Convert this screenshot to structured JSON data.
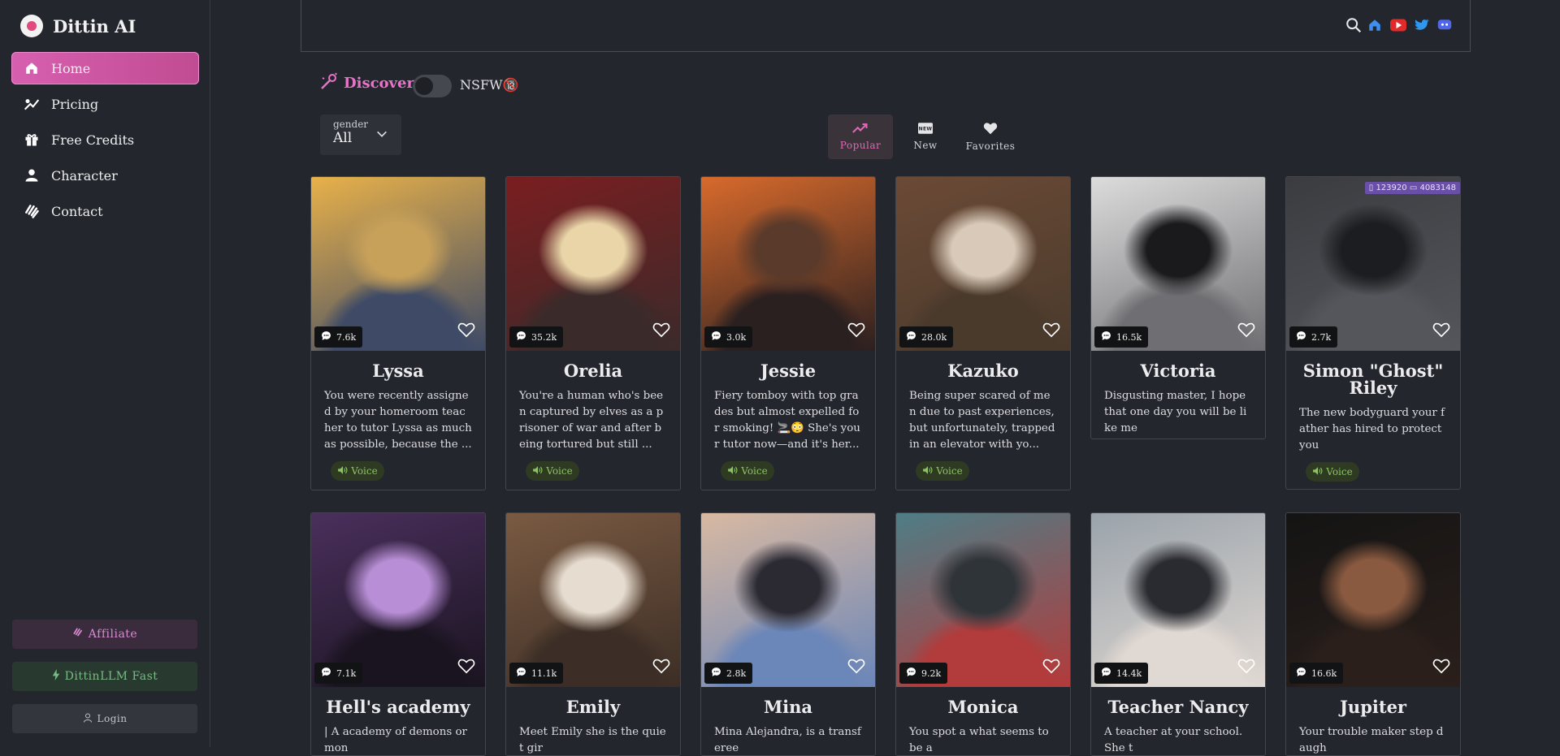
{
  "app": {
    "name": "Dittin AI"
  },
  "sidebar": {
    "items": [
      {
        "label": "Home",
        "icon": "home-icon",
        "active": true
      },
      {
        "label": "Pricing",
        "icon": "pricing-icon",
        "active": false
      },
      {
        "label": "Free Credits",
        "icon": "gift-icon",
        "active": false
      },
      {
        "label": "Character",
        "icon": "person-icon",
        "active": false
      },
      {
        "label": "Contact",
        "icon": "contact-icon",
        "active": false
      }
    ],
    "affiliate_label": "Affiliate",
    "llm_label": "DittinLLM Fast",
    "login_label": "Login"
  },
  "header": {
    "social": [
      "home-icon",
      "youtube-icon",
      "twitter-icon",
      "discord-icon"
    ]
  },
  "discover": {
    "title": "Discover",
    "nsfw_label": "NSFW🔞",
    "nsfw_on": false
  },
  "filter": {
    "gender_label": "gender",
    "gender_value": "All"
  },
  "tabs": [
    {
      "label": "Popular",
      "icon": "trending-icon",
      "active": true
    },
    {
      "label": "New",
      "icon": "new-icon",
      "active": false
    },
    {
      "label": "Favorites",
      "icon": "heart-icon",
      "active": false
    }
  ],
  "voice_label": "Voice",
  "characters": [
    {
      "name": "Lyssa",
      "count": "7.6k",
      "desc": "You were recently assigned by your homeroom teacher to tutor Lyssa as much as possible, because the ...",
      "voice": true,
      "colors": [
        "#e8b14a",
        "#c7a15a",
        "#3e4a66"
      ]
    },
    {
      "name": "Orelia",
      "count": "35.2k",
      "desc": "You're a human who's been captured by elves as a prisoner of war and after being tortured but still ...",
      "voice": true,
      "colors": [
        "#7a1e20",
        "#e9d5a8",
        "#3b2a2a"
      ]
    },
    {
      "name": "Jessie",
      "count": "3.0k",
      "desc": "Fiery tomboy with top grades but almost expelled for smoking! 🚬😳 She's your tutor now—and it's her...",
      "voice": true,
      "colors": [
        "#d86a2c",
        "#5a3a2a",
        "#2b2020"
      ]
    },
    {
      "name": "Kazuko",
      "count": "28.0k",
      "desc": "Being super scared of men due to past experiences, but unfortunately, trapped in an elevator with yo...",
      "voice": true,
      "colors": [
        "#6b4a36",
        "#d8c9b8",
        "#4a3a2c"
      ]
    },
    {
      "name": "Victoria",
      "count": "16.5k",
      "desc": "Disgusting master, I hope that one day you will be like me",
      "voice": false,
      "colors": [
        "#dcdcdc",
        "#1a1a1d",
        "#6f6f73"
      ]
    },
    {
      "name": "Simon \"Ghost\" Riley",
      "count": "2.7k",
      "desc": "The new bodyguard your father has hired to protect you",
      "voice": true,
      "colors": [
        "#3b3c40",
        "#1c1d20",
        "#55565b"
      ],
      "stats": [
        "123920",
        "4083148"
      ]
    },
    {
      "name": "Hell's academy",
      "count": "7.1k",
      "desc": "| A academy of demons or mon",
      "voice": false,
      "colors": [
        "#4a2f5c",
        "#b88fd6",
        "#1a1420"
      ]
    },
    {
      "name": "Emily",
      "count": "11.1k",
      "desc": "Meet Emily she is the quiet gir",
      "voice": false,
      "colors": [
        "#7a5a42",
        "#e6ddd0",
        "#3c2e26"
      ]
    },
    {
      "name": "Mina",
      "count": "2.8k",
      "desc": "Mina Alejandra, is a transferee",
      "voice": false,
      "colors": [
        "#d8b9a2",
        "#2b2a33",
        "#6b86b8"
      ]
    },
    {
      "name": "Monica",
      "count": "9.2k",
      "desc": "You spot a what seems to be a",
      "voice": false,
      "colors": [
        "#4f7d86",
        "#2e3438",
        "#b23b3b"
      ]
    },
    {
      "name": "Teacher Nancy",
      "count": "14.4k",
      "desc": "A teacher at your school. She t",
      "voice": false,
      "colors": [
        "#9aa3ab",
        "#2a2b30",
        "#e0d8d2"
      ]
    },
    {
      "name": "Jupiter",
      "count": "16.6k",
      "desc": "Your trouble maker step daugh",
      "voice": false,
      "colors": [
        "#141414",
        "#8a5a40",
        "#2a1f1b"
      ]
    }
  ]
}
